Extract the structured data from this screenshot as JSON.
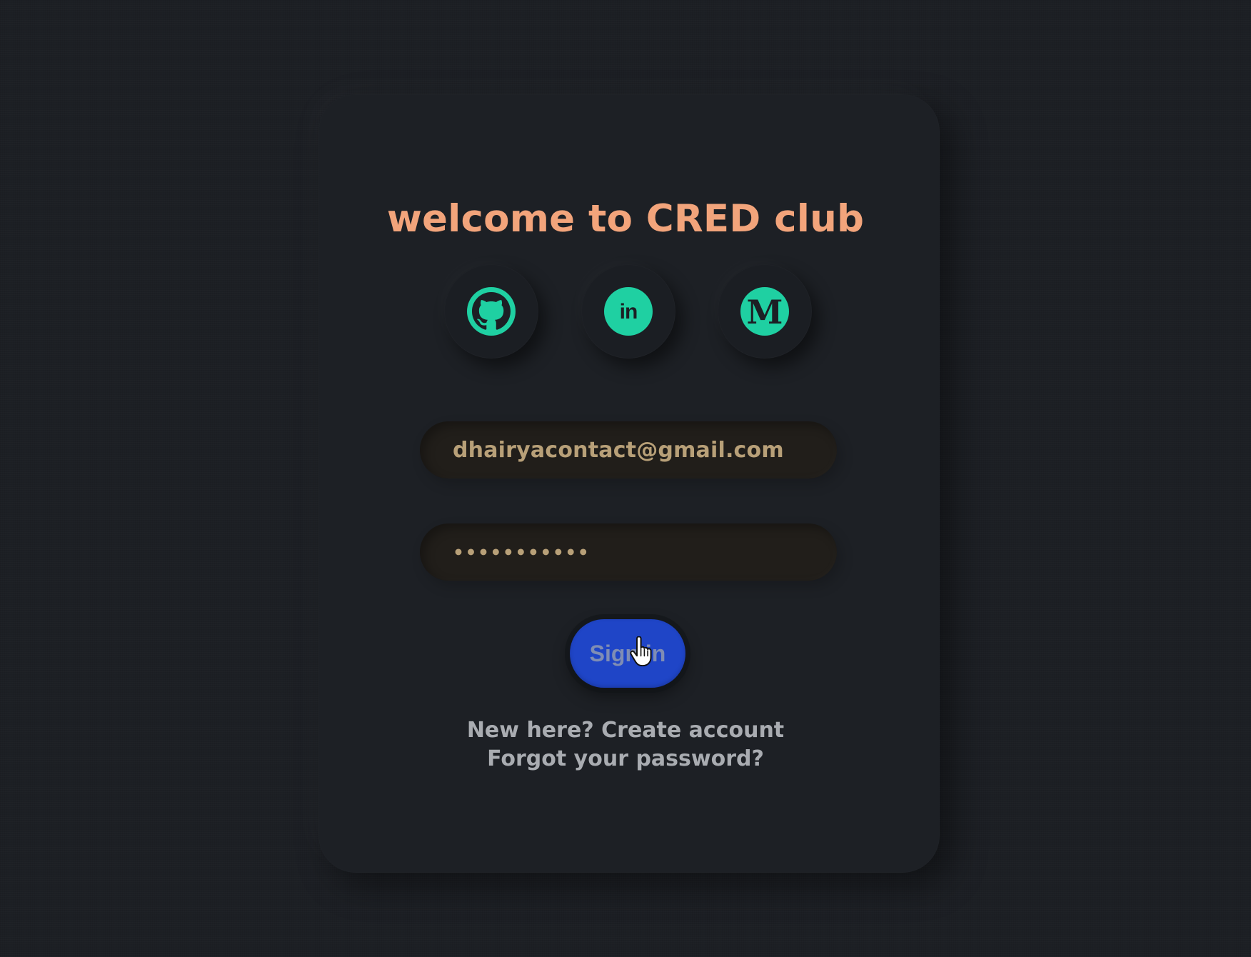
{
  "page": {
    "title": "welcome to CRED club",
    "accent_color": "#f2a47b",
    "social_color": "#1fd0a2",
    "button_color": "#1f45c7",
    "background_color": "#1c1f24"
  },
  "social": [
    {
      "name": "GitHub",
      "icon": "github-icon"
    },
    {
      "name": "LinkedIn",
      "icon": "linkedin-icon",
      "glyph": "in"
    },
    {
      "name": "Medium",
      "icon": "medium-icon",
      "glyph": "M"
    }
  ],
  "form": {
    "email_value": "dhairyacontact@gmail.com",
    "password_value": "•••••••••••",
    "signin_label": "Sign in"
  },
  "links": {
    "create_account": "New here? Create account",
    "forgot_password": "Forgot your password?"
  },
  "cursor": {
    "icon": "hand-pointer-icon"
  }
}
